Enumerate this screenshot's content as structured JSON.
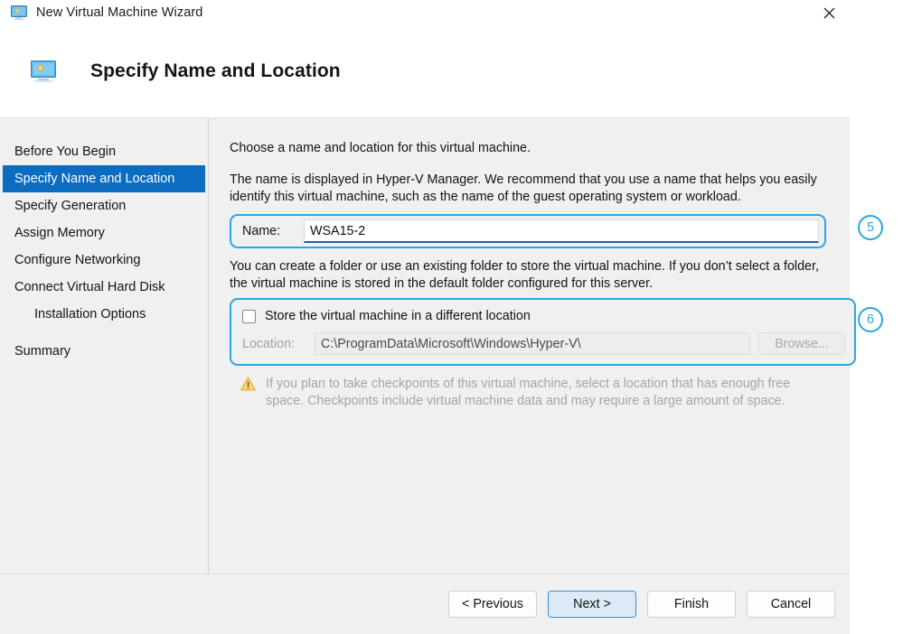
{
  "titlebar": {
    "title": "New Virtual Machine Wizard",
    "icon": "virtual-machine-monitor-icon",
    "close_label": "✕"
  },
  "header": {
    "title": "Specify Name and Location",
    "icon": "virtual-machine-monitor-icon"
  },
  "sidebar": {
    "items": [
      {
        "label": "Before You Begin",
        "selected": false,
        "indent": false
      },
      {
        "label": "Specify Name and Location",
        "selected": true,
        "indent": false
      },
      {
        "label": "Specify Generation",
        "selected": false,
        "indent": false
      },
      {
        "label": "Assign Memory",
        "selected": false,
        "indent": false
      },
      {
        "label": "Configure Networking",
        "selected": false,
        "indent": false
      },
      {
        "label": "Connect Virtual Hard Disk",
        "selected": false,
        "indent": false
      },
      {
        "label": "Installation Options",
        "selected": false,
        "indent": true
      },
      {
        "label": "Summary",
        "selected": false,
        "indent": false
      }
    ]
  },
  "content": {
    "intro": "Choose a name and location for this virtual machine.",
    "description": "The name is displayed in Hyper-V Manager. We recommend that you use a name that helps you easily identify this virtual machine, such as the name of the guest operating system or workload.",
    "name_label": "Name:",
    "name_value": "WSA15-2",
    "folder_description": "You can create a folder or use an existing folder to store the virtual machine. If you don’t select a folder, the virtual machine is stored in the default folder configured for this server.",
    "store_checkbox_label": "Store the virtual machine in a different location",
    "store_checkbox_checked": false,
    "location_label": "Location:",
    "location_value": "C:\\ProgramData\\Microsoft\\Windows\\Hyper-V\\",
    "browse_label": "Browse...",
    "warning_icon": "warning-triangle-icon",
    "warning_text": "If you plan to take checkpoints of this virtual machine, select a location that has enough free space. Checkpoints include virtual machine data and may require a large amount of space."
  },
  "footer": {
    "previous_label": "< Previous",
    "next_label": "Next >",
    "finish_label": "Finish",
    "cancel_label": "Cancel"
  },
  "annotations": {
    "badge5": "5",
    "badge6": "6",
    "color": "#28a8e0"
  },
  "colors": {
    "selection_blue": "#0b6cc0",
    "annotation_cyan": "#28a8e0",
    "default_button_fill": "#dceaf7",
    "body_gray": "#f0f0f0",
    "warning_amber": "#f0b323"
  }
}
